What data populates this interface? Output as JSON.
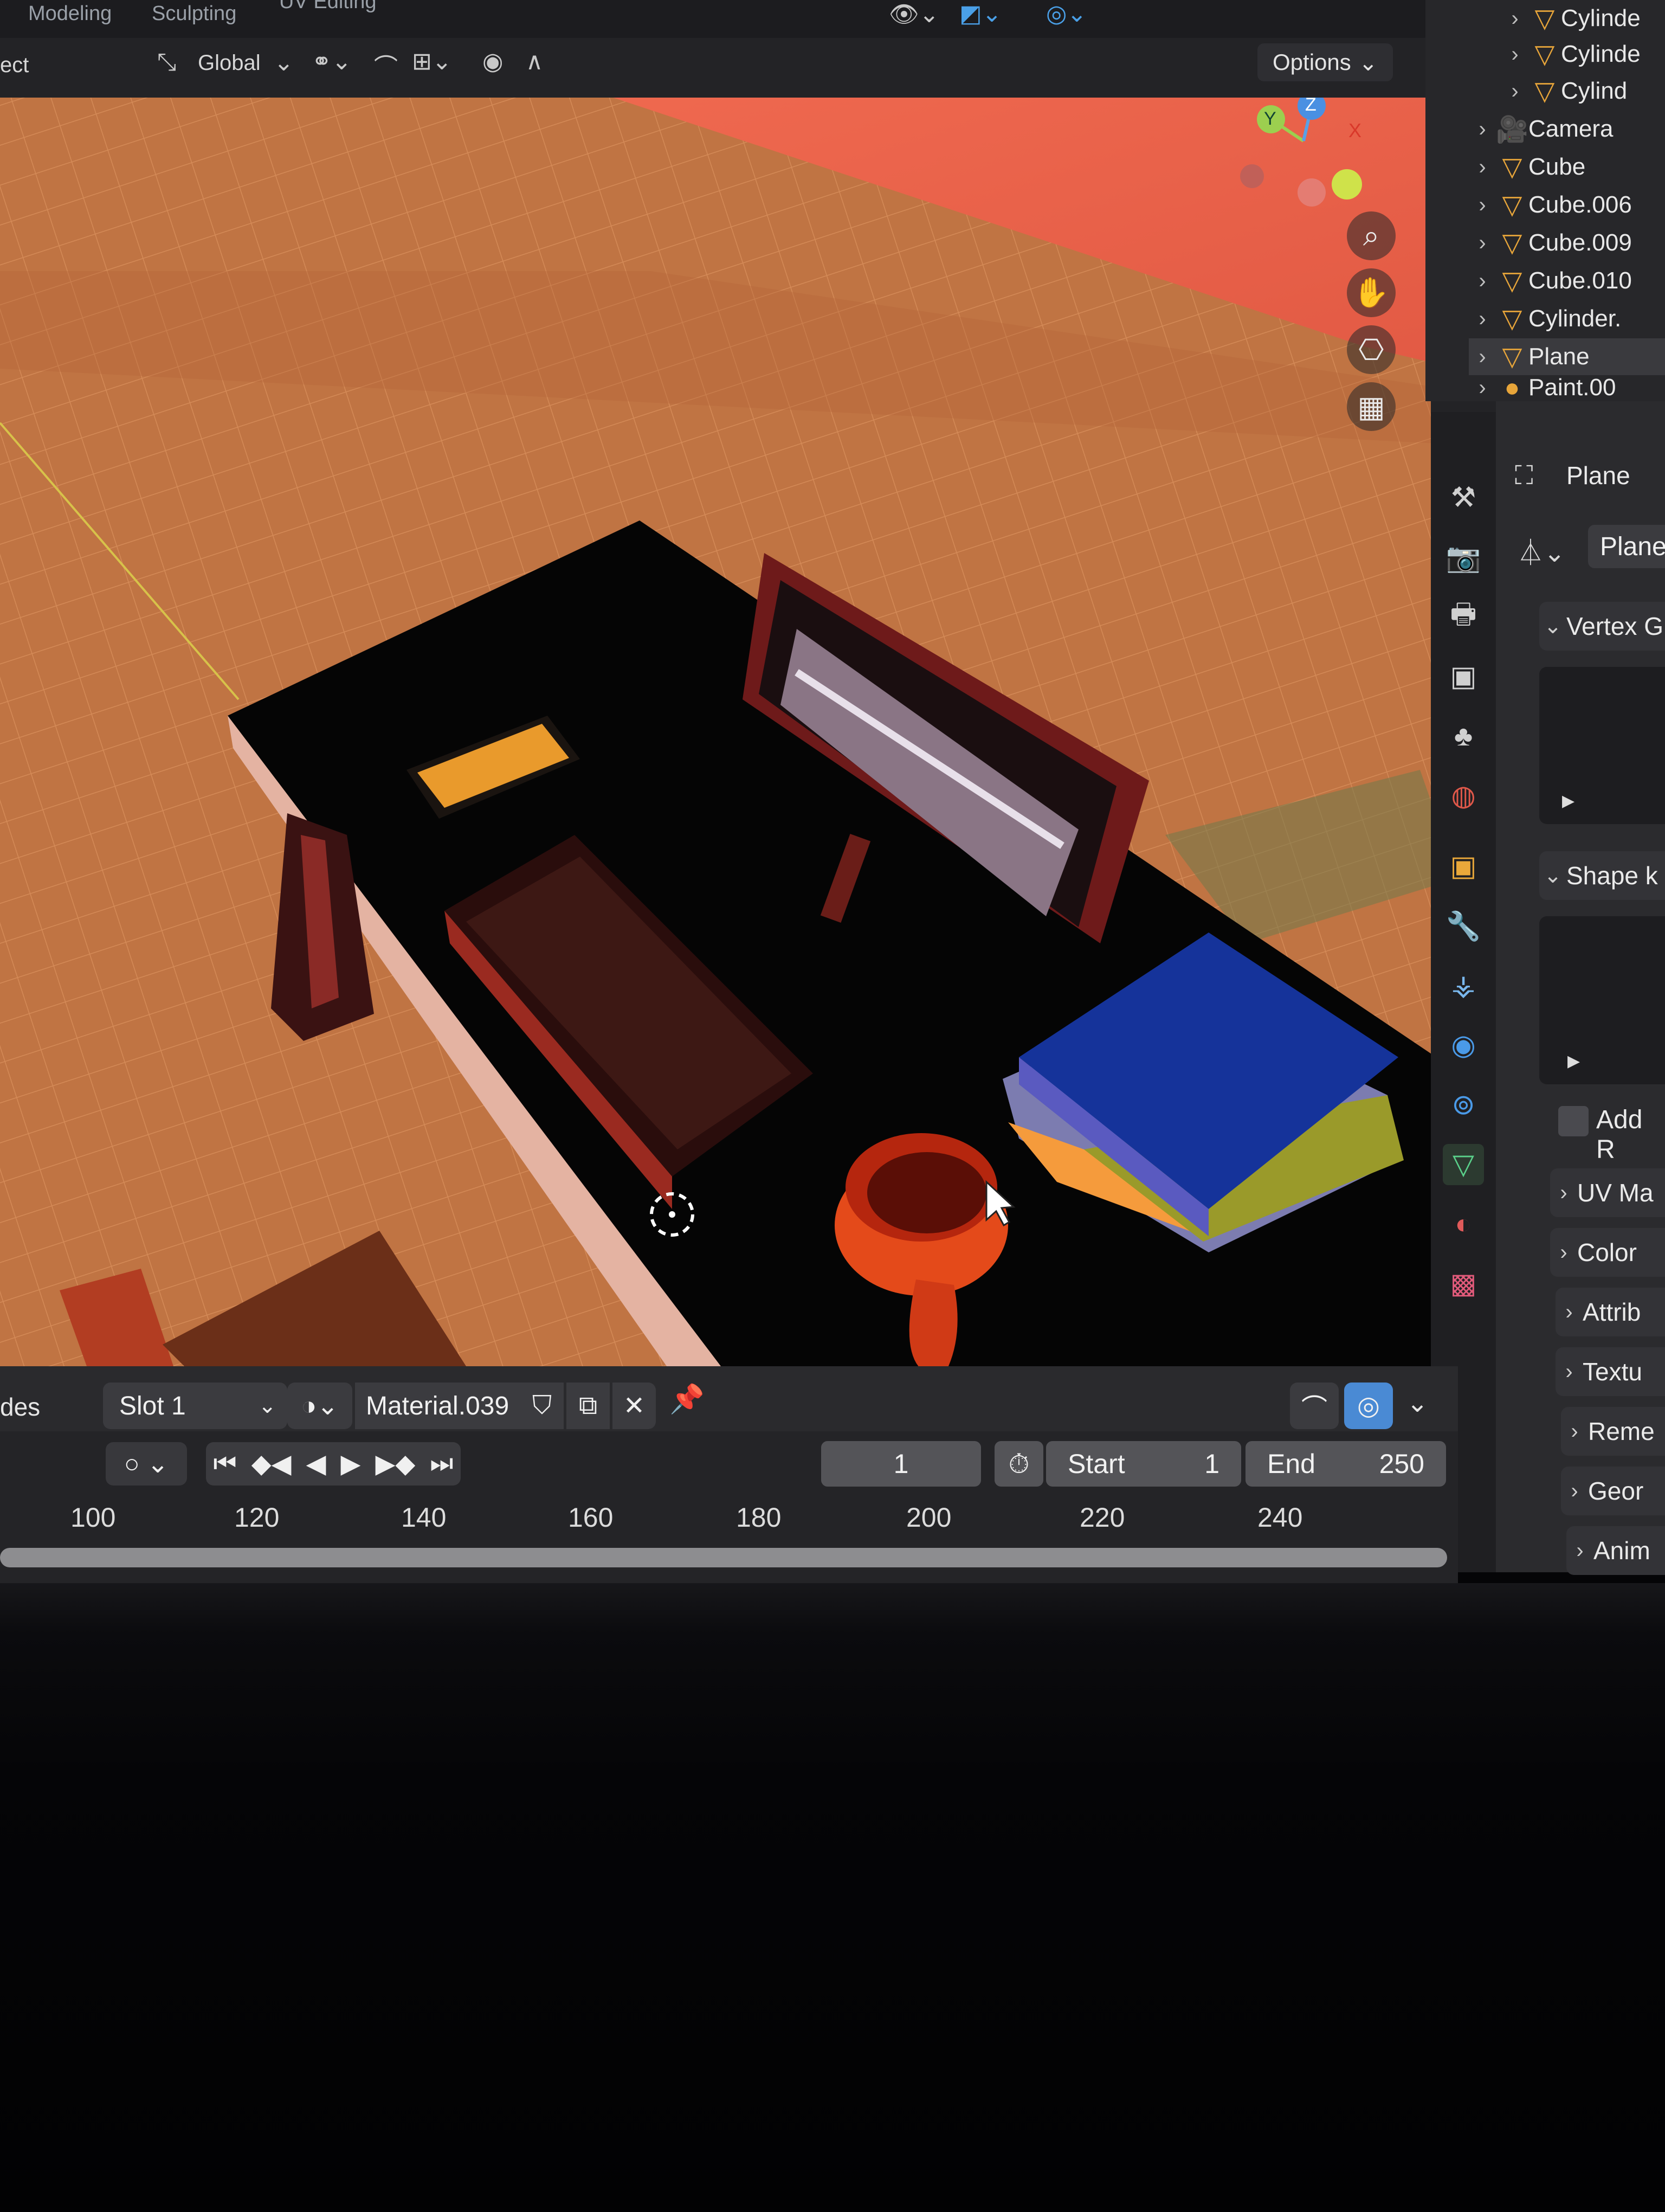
{
  "workspace_tabs": [
    "Modeling",
    "Sculpting",
    "UV Editing"
  ],
  "header": {
    "mode_fragment": "ect",
    "transform_orientation": "Global",
    "options_label": "Options"
  },
  "gizmo": {
    "y": "Y",
    "z": "Z",
    "x": "X"
  },
  "outliner": {
    "items": [
      "Cylinde",
      "Cylinde",
      "Cylind",
      "Camera",
      "Cube",
      "Cube.006",
      "Cube.009",
      "Cube.010",
      "Cylinder.",
      "Plane",
      "Paint.00"
    ]
  },
  "properties": {
    "object_name": "Plane",
    "mesh_name": "Plane",
    "panels": {
      "vertex_groups": "Vertex G",
      "shape_keys": "Shape k",
      "add_rest": "Add R",
      "uv_maps": "UV Ma",
      "color": "Color",
      "attributes": "Attrib",
      "texture": "Textu",
      "remesh": "Reme",
      "geometry": "Geor",
      "animation": "Anim"
    }
  },
  "material_bar": {
    "left_fragment": "des",
    "slot": "Slot 1",
    "material": "Material.039"
  },
  "timeline": {
    "current_frame": "1",
    "start_label": "Start",
    "start_value": "1",
    "end_label": "End",
    "end_value": "250",
    "ticks": [
      "100",
      "120",
      "140",
      "160",
      "180",
      "200",
      "220",
      "240"
    ]
  },
  "colors": {
    "accent_orange": "#e7a53a",
    "ui_dark": "#232326",
    "floor": "#c47a45",
    "background_wall": "#e8604a"
  }
}
